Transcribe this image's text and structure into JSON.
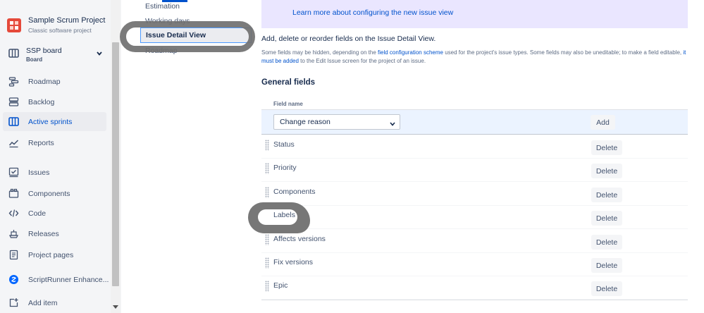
{
  "sidebar": {
    "project_name": "Sample Scrum Project",
    "project_type": "Classic software project",
    "board_name": "SSP board",
    "board_subtitle": "Board",
    "nav": [
      {
        "label": "Roadmap",
        "icon": "roadmap-icon"
      },
      {
        "label": "Backlog",
        "icon": "backlog-icon"
      },
      {
        "label": "Active sprints",
        "icon": "active-sprints-icon",
        "active": true
      },
      {
        "label": "Reports",
        "icon": "reports-icon"
      },
      {
        "label": "Issues",
        "icon": "issues-icon"
      },
      {
        "label": "Components",
        "icon": "components-icon"
      },
      {
        "label": "Code",
        "icon": "code-icon"
      },
      {
        "label": "Releases",
        "icon": "releases-icon"
      },
      {
        "label": "Project pages",
        "icon": "project-pages-icon"
      },
      {
        "label": "ScriptRunner Enhance...",
        "icon": "scriptrunner-icon"
      },
      {
        "label": "Add item",
        "icon": "add-item-icon"
      }
    ]
  },
  "settings_nav": {
    "items": [
      "Estimation",
      "Working days",
      "Issue Detail View",
      "Roadmap"
    ],
    "selected": "Issue Detail View"
  },
  "banner": {
    "link_text": "Learn more about configuring the new issue view"
  },
  "main": {
    "intro": "Add, delete or reorder fields on the Issue Detail View.",
    "desc_part1": "Some fields may be hidden, depending on the ",
    "desc_link1": "field configuration scheme",
    "desc_part2": " used for the project's issue types. Some fields may also be uneditable; to make a field editable, ",
    "desc_link2": "it must be added",
    "desc_part3": " to the Edit Issue screen for the project of an issue.",
    "section_title": "General fields",
    "column_header": "Field name",
    "select_value": "Change reason",
    "add_label": "Add",
    "delete_label": "Delete",
    "fields": [
      "Status",
      "Priority",
      "Components",
      "Labels",
      "Affects versions",
      "Fix versions",
      "Epic"
    ]
  },
  "colors": {
    "accent": "#0052cc",
    "banner_bg": "#eae6ff",
    "add_row_bg": "#ebf3ff",
    "sidebar_bg": "#f4f5f7",
    "annotation": "#707070"
  }
}
